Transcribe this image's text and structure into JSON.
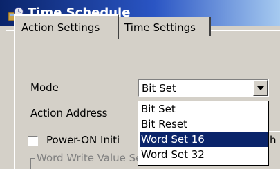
{
  "window": {
    "title": "Time Schedule",
    "icon": "time-schedule-icon"
  },
  "tabs": [
    {
      "label": "Action Settings",
      "active": true
    },
    {
      "label": "Time Settings",
      "active": false
    }
  ],
  "form": {
    "mode_label": "Mode",
    "mode_value": "Bit Set",
    "action_address_label": "Action Address",
    "power_on_label": "Power-ON Initi",
    "power_on_checked": false,
    "truncated_button_text": "h",
    "group_label": "Word Write Value Setting"
  },
  "dropdown": {
    "options": [
      "Bit Set",
      "Bit Reset",
      "Word Set 16",
      "Word Set 32"
    ],
    "selected_index": 2
  },
  "colors": {
    "title_bar": "#0a246a",
    "selection": "#0a246a",
    "face": "#d4d0c8"
  }
}
